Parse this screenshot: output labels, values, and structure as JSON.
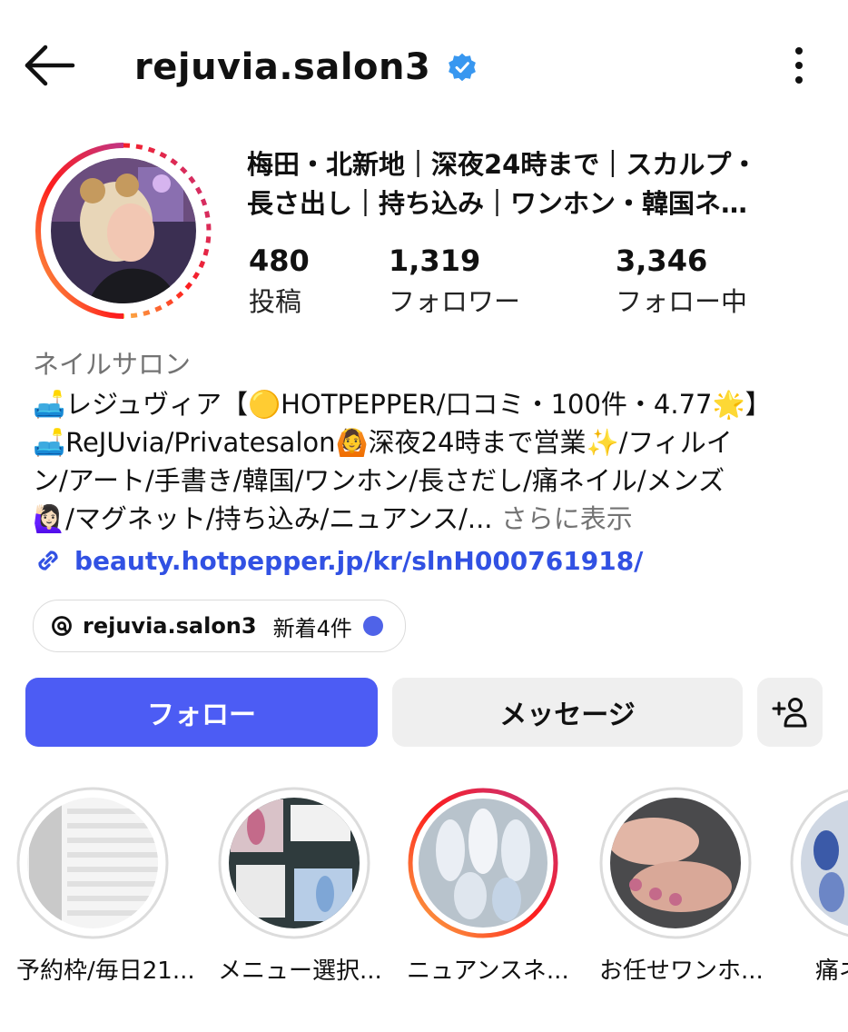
{
  "header": {
    "username": "rejuvia.salon3",
    "verified_icon": "verified-badge-icon",
    "back_icon": "arrow-left-icon",
    "more_icon": "more-vertical-icon"
  },
  "profile": {
    "top_bio_line1": "梅田・北新地｜深夜24時まで｜スカルプ・",
    "top_bio_line2": "長さ出し｜持ち込み｜ワンホン・韓国ネ…",
    "stats": [
      {
        "value": "480",
        "label": "投稿"
      },
      {
        "value": "1,319",
        "label": "フォロワー"
      },
      {
        "value": "3,346",
        "label": "フォロー中"
      }
    ],
    "category": "ネイルサロン",
    "description_lines": [
      "🛋️レジュヴィア【🟡HOTPEPPER/口コミ・100件・4.77🌟】",
      "🛋️ReJUvia/Privatesalon🙆深夜24時まで営業✨/フィルイ",
      "ン/アート/手書き/韓国/ワンホン/長さだし/痛ネイル/メンズ",
      "🙋🏻‍♀️/マグネット/持ち込み/ニュアンス/..."
    ],
    "see_more": "さらに表示",
    "link": "beauty.hotpepper.jp/kr/slnH000761918/"
  },
  "threads": {
    "handle": "rejuvia.salon3",
    "new_posts": "新着4件",
    "dot_color": "#4f63e8"
  },
  "actions": {
    "follow": "フォロー",
    "message": "メッセージ",
    "add_person_icon": "add-person-icon"
  },
  "highlights": [
    {
      "label": "予約枠/毎日21...",
      "new": false
    },
    {
      "label": "メニュー選択...",
      "new": false
    },
    {
      "label": "ニュアンスネ...",
      "new": true
    },
    {
      "label": "お任せワンホ...",
      "new": false
    },
    {
      "label": "痛ネ",
      "new": false
    }
  ],
  "colors": {
    "accent_blue": "#4c5cf4",
    "link_blue": "#3151e3",
    "verified_blue": "#3897f0",
    "muted_gray": "#737373"
  }
}
